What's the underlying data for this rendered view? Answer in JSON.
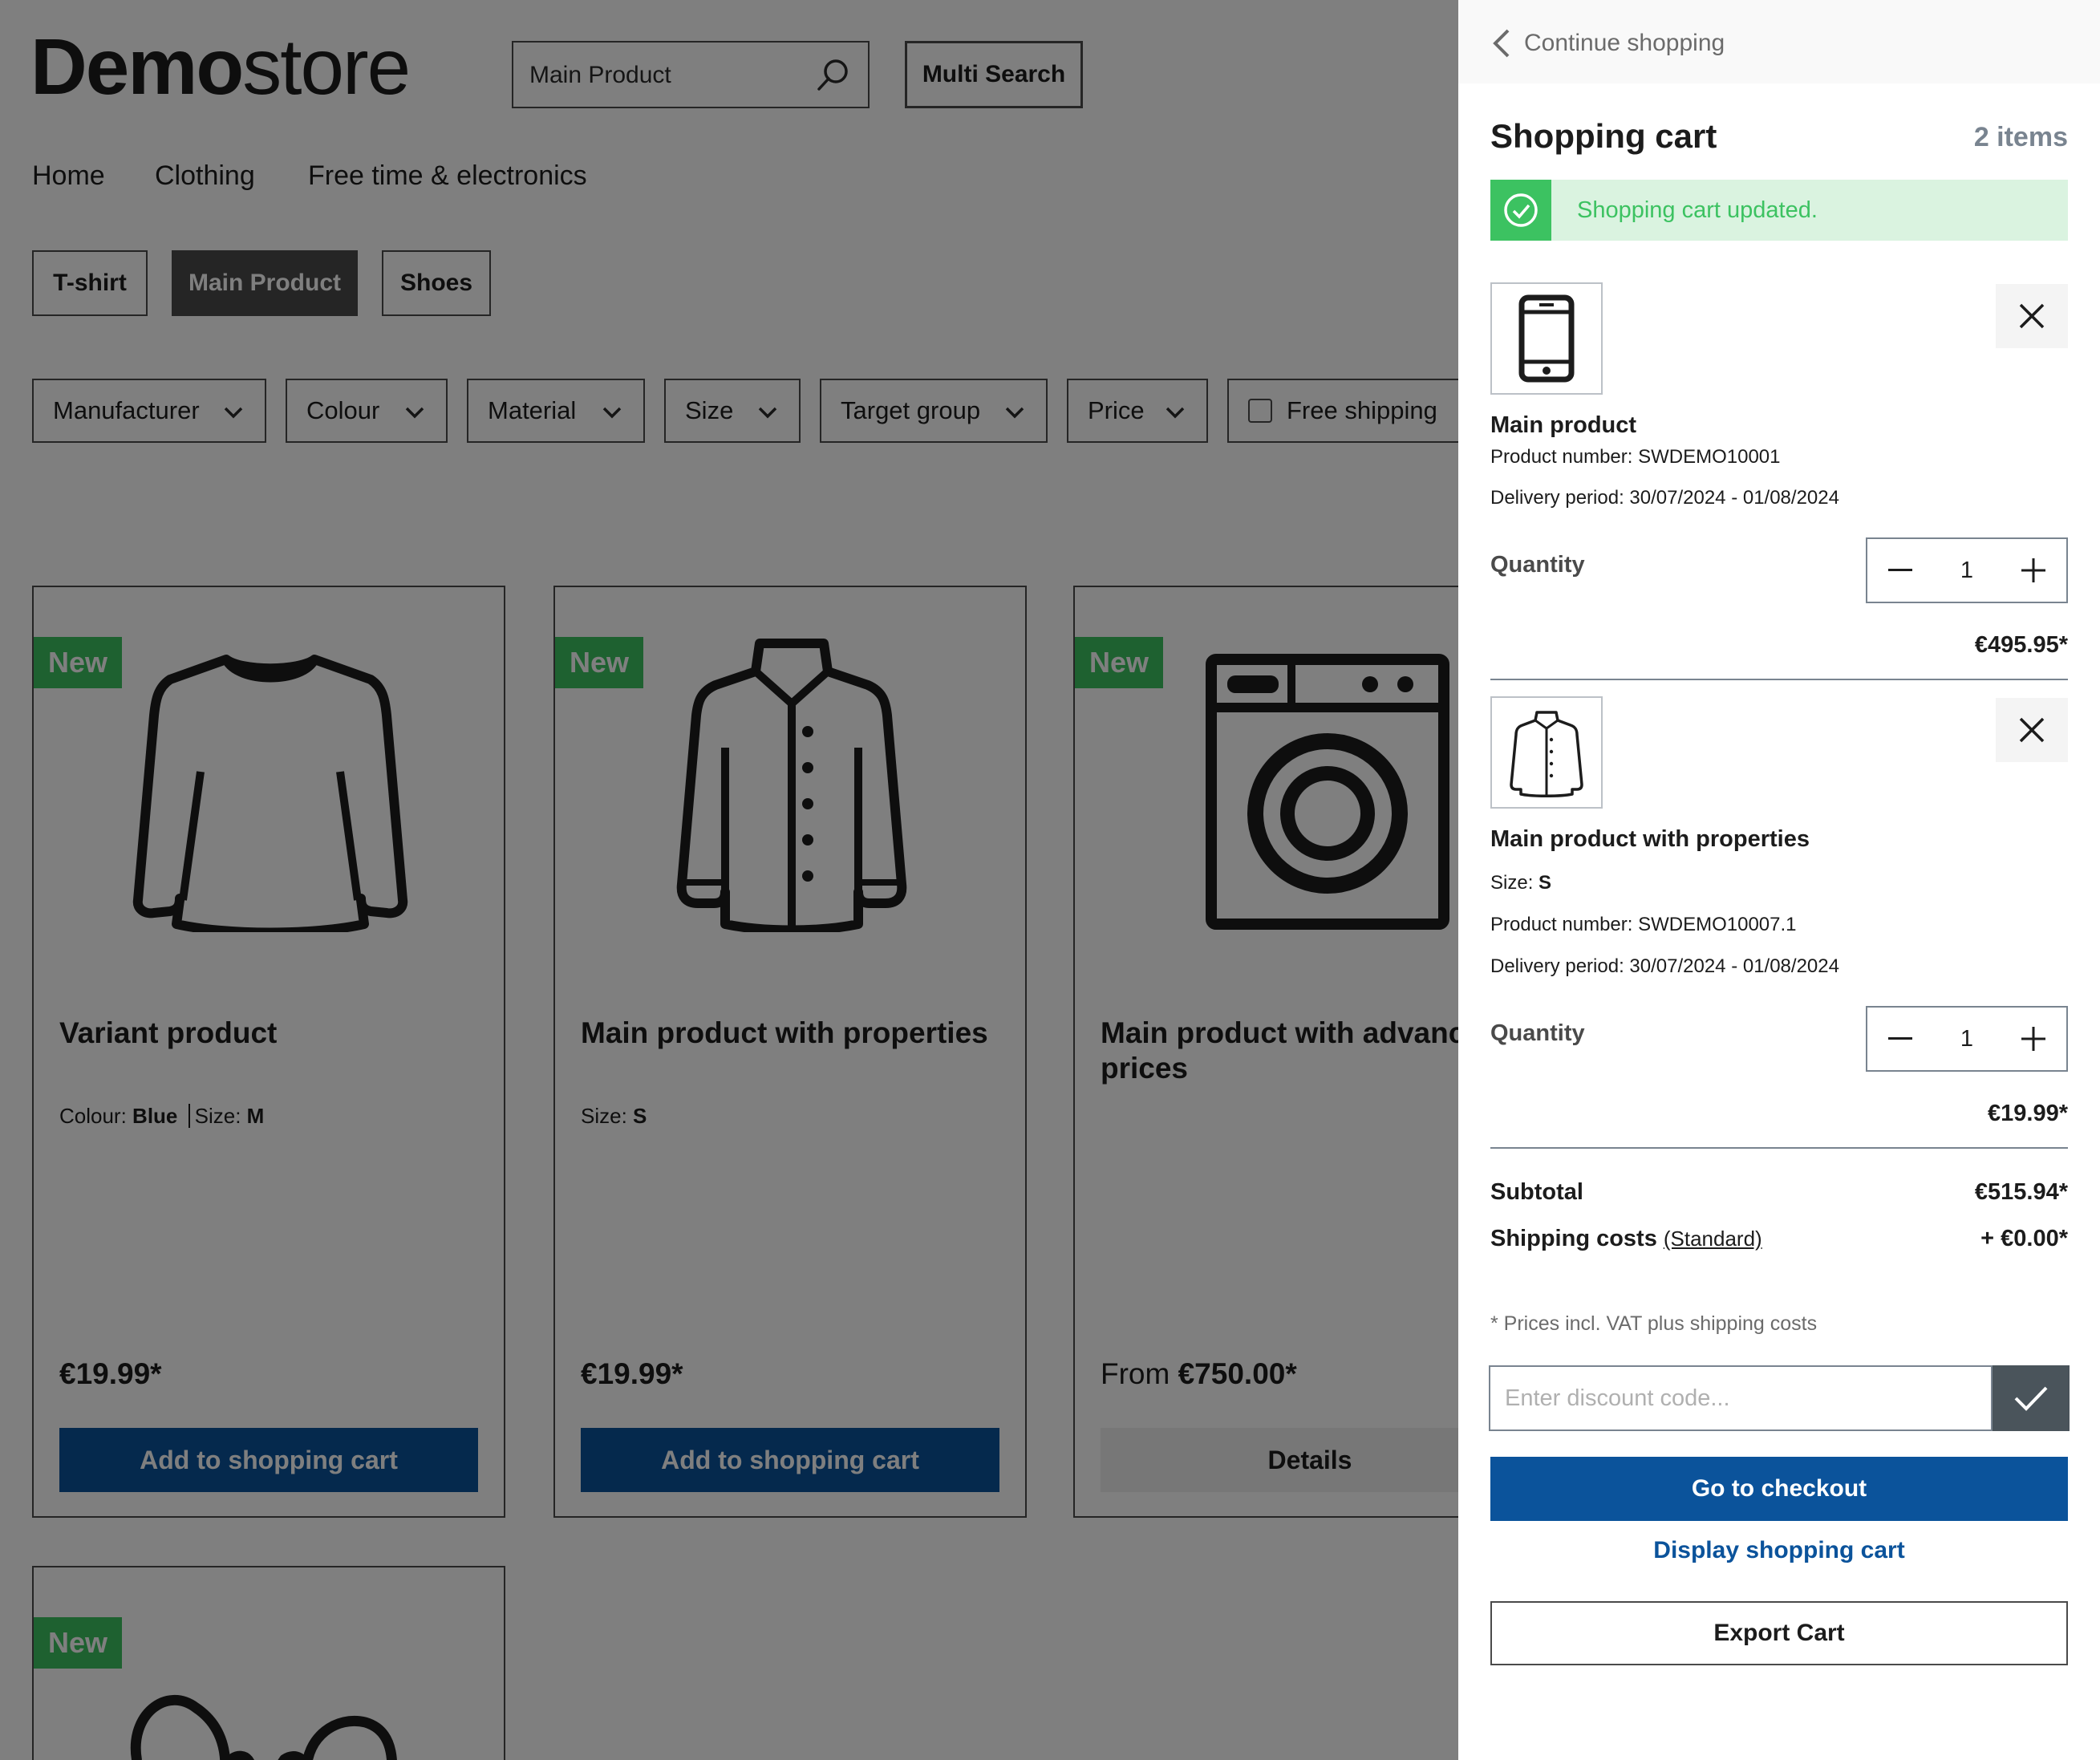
{
  "header": {
    "logo_bold": "Demo",
    "logo_light": "store",
    "search_value": "Main Product",
    "multi_search_label": "Multi Search"
  },
  "nav": [
    "Home",
    "Clothing",
    "Free time & electronics"
  ],
  "categories": [
    {
      "label": "T-shirt",
      "active": false
    },
    {
      "label": "Main Product",
      "active": true
    },
    {
      "label": "Shoes",
      "active": false
    }
  ],
  "filters": [
    "Manufacturer",
    "Colour",
    "Material",
    "Size",
    "Target group",
    "Price"
  ],
  "free_shipping_label": "Free shipping",
  "products": [
    {
      "badge": "New",
      "name": "Variant product",
      "prop1_label": "Colour: ",
      "prop1_value": "Blue",
      "prop2_label": "Size: ",
      "prop2_value": "M",
      "price": "€19.99*",
      "button": "Add to shopping cart",
      "icon": "sweater-icon"
    },
    {
      "badge": "New",
      "name": "Main product with properties",
      "prop1_label": "Size: ",
      "prop1_value": "S",
      "price": "€19.99*",
      "button": "Add to shopping cart",
      "icon": "shirt-icon"
    },
    {
      "badge": "New",
      "name": "Main product with advanc prices",
      "price_prefix": "From ",
      "price": "€750.00*",
      "button": "Details",
      "icon": "washing-machine-icon"
    },
    {
      "badge": "New",
      "icon": "mittens-icon"
    }
  ],
  "cart": {
    "continue_label": "Continue shopping",
    "title": "Shopping cart",
    "count": "2 items",
    "alert": "Shopping cart updated.",
    "quantity_label": "Quantity",
    "items": [
      {
        "name": "Main product",
        "product_number": "Product number: SWDEMO10001",
        "delivery": "Delivery period: 30/07/2024 - 01/08/2024",
        "quantity": "1",
        "price": "€495.95*",
        "icon": "phone-icon"
      },
      {
        "name": "Main product with properties",
        "size_label": "Size: ",
        "size_value": "S",
        "product_number": "Product number: SWDEMO10007.1",
        "delivery": "Delivery period: 30/07/2024 - 01/08/2024",
        "quantity": "1",
        "price": "€19.99*",
        "icon": "shirt-icon"
      }
    ],
    "subtotal_label": "Subtotal",
    "subtotal": "€515.94*",
    "shipping_label": "Shipping costs",
    "shipping_method": "(Standard)",
    "shipping_value": "+ €0.00*",
    "vat_note": "* Prices incl. VAT plus shipping costs",
    "discount_placeholder": "Enter discount code...",
    "checkout_label": "Go to checkout",
    "display_label": "Display shopping cart",
    "export_label": "Export Cart"
  },
  "colors": {
    "primary": "#0b539b",
    "success": "#3cc261",
    "success_bg": "#daf3e0",
    "dark": "#4a4a4a"
  }
}
